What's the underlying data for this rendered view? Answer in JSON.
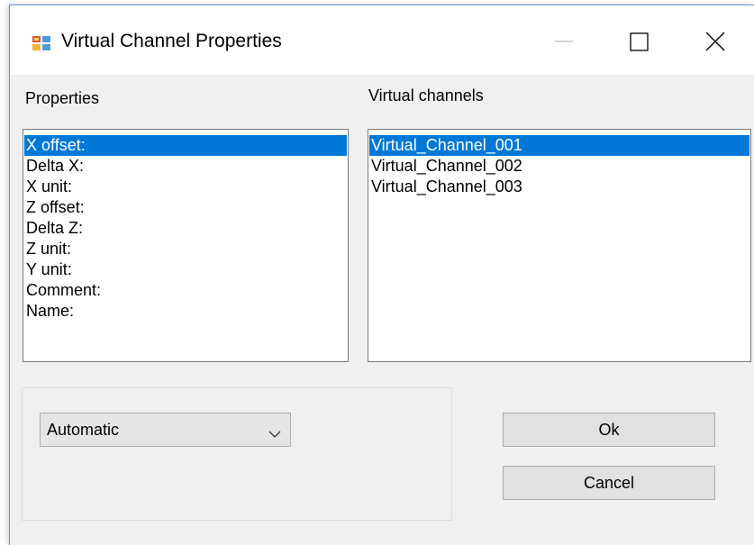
{
  "window": {
    "title": "Virtual Channel Properties",
    "controls": {
      "minimize": "minimize-icon",
      "maximize": "maximize-icon",
      "close": "close-icon"
    }
  },
  "properties": {
    "label": "Properties",
    "items": [
      {
        "label": "X offset:",
        "selected": true
      },
      {
        "label": "Delta X:",
        "selected": false
      },
      {
        "label": "X unit:",
        "selected": false
      },
      {
        "label": "Z offset:",
        "selected": false
      },
      {
        "label": "Delta Z:",
        "selected": false
      },
      {
        "label": "Z unit:",
        "selected": false
      },
      {
        "label": "Y unit:",
        "selected": false
      },
      {
        "label": "Comment:",
        "selected": false
      },
      {
        "label": "Name:",
        "selected": false
      }
    ]
  },
  "virtual_channels": {
    "label": "Virtual channels",
    "items": [
      {
        "label": "Virtual_Channel_001",
        "selected": true
      },
      {
        "label": "Virtual_Channel_002",
        "selected": false
      },
      {
        "label": "Virtual_Channel_003",
        "selected": false
      }
    ]
  },
  "mode_select": {
    "value": "Automatic"
  },
  "buttons": {
    "ok": "Ok",
    "cancel": "Cancel"
  },
  "colors": {
    "selection": "#0078d7",
    "dialog_background": "#f0f0f0"
  }
}
